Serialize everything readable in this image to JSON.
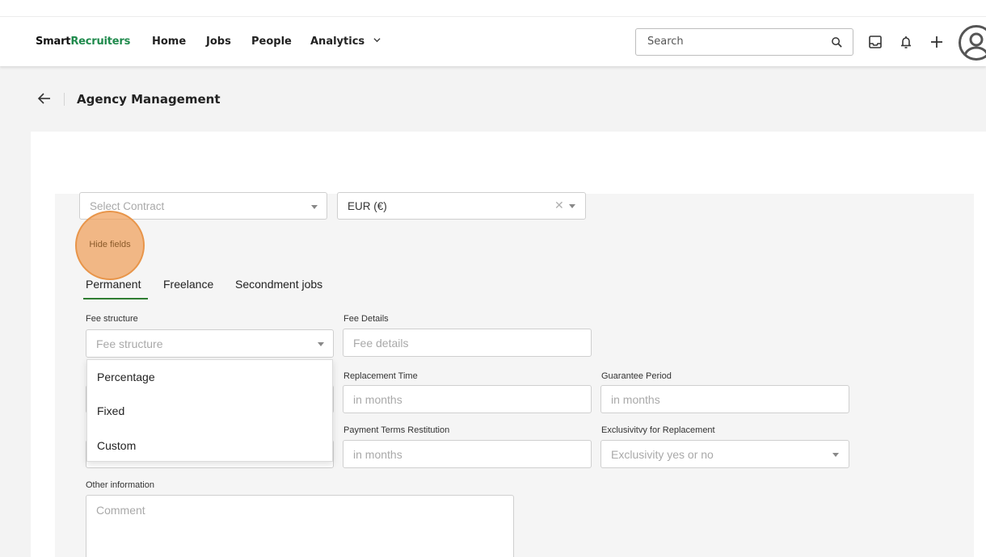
{
  "nav": {
    "logo_smart": "Smart",
    "logo_recruiters": "Recruiters",
    "links": [
      "Home",
      "Jobs",
      "People",
      "Analytics"
    ],
    "search_placeholder": "Search"
  },
  "header": {
    "title": "Agency Management"
  },
  "form": {
    "contract_placeholder": "Select Contract",
    "currency_value": "EUR (€)",
    "hide_fields_label": "Hide fields",
    "tabs": [
      "Permanent",
      "Freelance",
      "Secondment jobs"
    ],
    "active_tab": "Permanent",
    "fee_structure_label": "Fee structure",
    "fee_structure_placeholder": "Fee structure",
    "fee_details_label": "Fee Details",
    "fee_details_placeholder": "Fee details",
    "replacement_time_label": "Replacement Time",
    "replacement_time_placeholder": "in months",
    "guarantee_period_label": "Guarantee Period",
    "guarantee_period_placeholder": "in months",
    "payment_terms_label": "Payment Terms Restitution",
    "payment_terms_placeholder": "in months",
    "exclusivity_label": "Exclusivitvy for Replacement",
    "exclusivity_placeholder": "Exclusivity yes or no",
    "other_info_label": "Other information",
    "comment_placeholder": "Comment"
  },
  "fee_dropdown": {
    "options": [
      "Percentage",
      "Fixed",
      "Custom"
    ]
  },
  "colors": {
    "brand_green": "#1f8a4c",
    "tab_underline": "#2e7d32",
    "highlight_orange": "#e8954a"
  }
}
